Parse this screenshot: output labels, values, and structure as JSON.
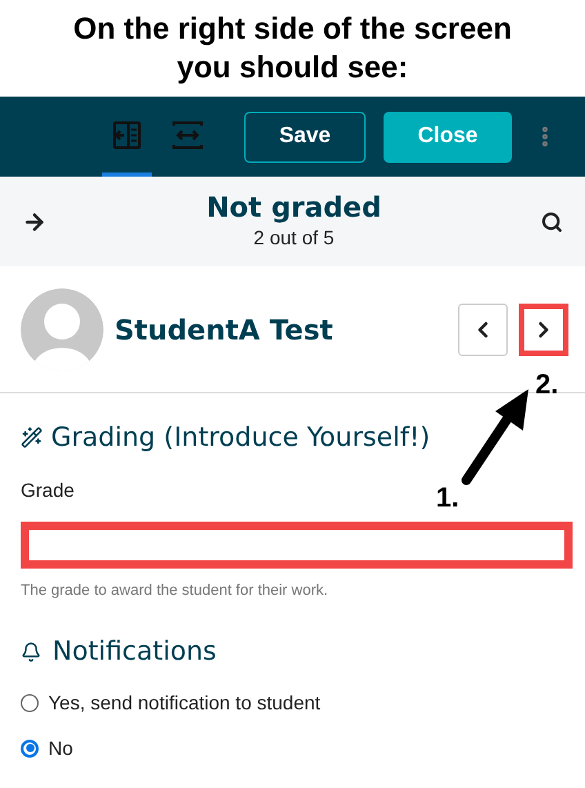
{
  "caption": "On the right side of the screen you should see:",
  "toolbar": {
    "view_buttons": [
      {
        "kind": "split",
        "selected": true
      },
      {
        "kind": "expand",
        "selected": false
      }
    ],
    "buttons": [
      {
        "label": "Save",
        "kind": "outline"
      },
      {
        "label": "Close",
        "kind": "filled"
      }
    ]
  },
  "filter": {
    "title": "Not graded",
    "count": "2 out of 5"
  },
  "student": {
    "name": "StudentA Test",
    "nav": [
      {
        "kind": "prev",
        "highlighted": false
      },
      {
        "kind": "next",
        "highlighted": true
      }
    ]
  },
  "grading": {
    "title": "Grading (Introduce Yourself!)",
    "label": "Grade",
    "highlighted": true,
    "help": "The grade to award the student for their work."
  },
  "notifications": {
    "title": "Notifications",
    "options": [
      {
        "label": "Yes, send notification to student",
        "selected": false
      },
      {
        "label": "No",
        "selected": true
      }
    ]
  },
  "annotations": [
    {
      "label": "1."
    },
    {
      "label": "2."
    }
  ]
}
